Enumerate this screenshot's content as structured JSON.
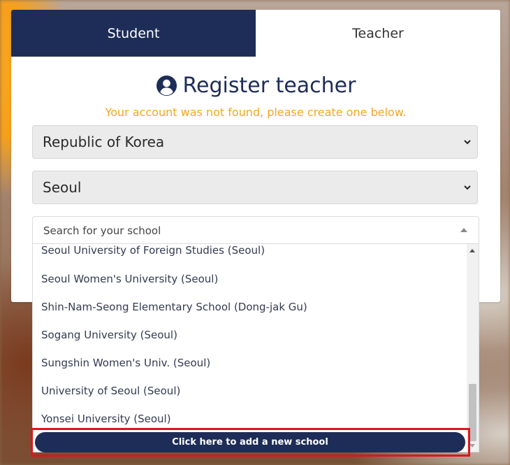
{
  "tabs": [
    {
      "label": "Student",
      "active": true
    },
    {
      "label": "Teacher",
      "active": false
    }
  ],
  "form": {
    "icon": "user-circle-icon",
    "title": "Register teacher",
    "notice": "Your account was not found, please create one below.",
    "country": "Republic of Korea",
    "region": "Seoul",
    "school_placeholder": "Search for your school"
  },
  "schools": [
    "Seoul University of Foreign Studies (Seoul)",
    "Seoul Women's University (Seoul)",
    "Shin-Nam-Seong Elementary School (Dong-jak Gu)",
    "Sogang University (Seoul)",
    "Sungshin Women's Univ. (Seoul)",
    "University of Seoul (Seoul)",
    "Yonsei University (Seoul)"
  ],
  "add_school_label": "Click here to add a new school",
  "colors": {
    "navy": "#1e2d57",
    "notice": "#f5a623",
    "highlight": "#e0141e"
  }
}
